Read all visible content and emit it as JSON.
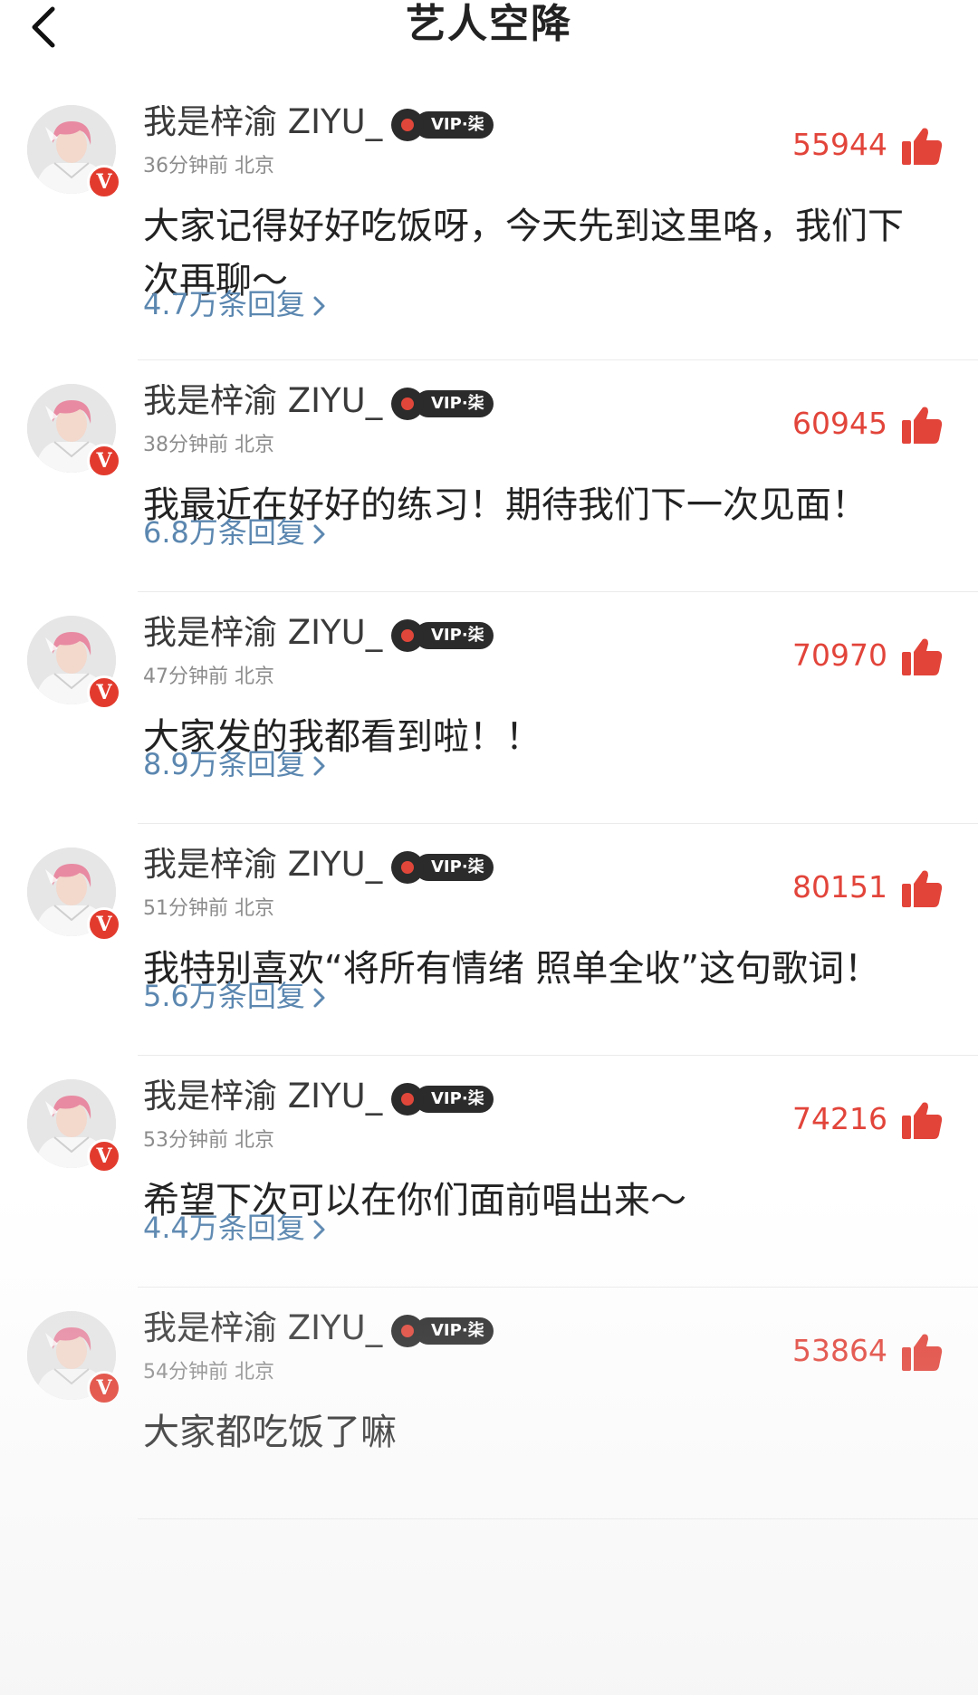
{
  "header": {
    "title": "艺人空降",
    "back_icon": "chevron-left-icon"
  },
  "colors": {
    "like": "#e2443a",
    "replies": "#5b87b0",
    "meta": "#8c8c8c",
    "verified_badge": "#e23b2e"
  },
  "comments": [
    {
      "username": "我是梓渝 ZIYU_",
      "vip_label": "VIP·柒",
      "badge": "V",
      "time": "36分钟前",
      "location": "北京",
      "likes": "55944",
      "content": "大家记得好好吃饭呀，今天先到这里咯，我们下次再聊～",
      "replies": "4.7万条回复"
    },
    {
      "username": "我是梓渝 ZIYU_",
      "vip_label": "VIP·柒",
      "badge": "V",
      "time": "38分钟前",
      "location": "北京",
      "likes": "60945",
      "content": "我最近在好好的练习！期待我们下一次见面！",
      "replies": "6.8万条回复"
    },
    {
      "username": "我是梓渝 ZIYU_",
      "vip_label": "VIP·柒",
      "badge": "V",
      "time": "47分钟前",
      "location": "北京",
      "likes": "70970",
      "content": "大家发的我都看到啦！！",
      "replies": "8.9万条回复"
    },
    {
      "username": "我是梓渝 ZIYU_",
      "vip_label": "VIP·柒",
      "badge": "V",
      "time": "51分钟前",
      "location": "北京",
      "likes": "80151",
      "content": "我特别喜欢“将所有情绪 照单全收”这句歌词！",
      "replies": "5.6万条回复"
    },
    {
      "username": "我是梓渝 ZIYU_",
      "vip_label": "VIP·柒",
      "badge": "V",
      "time": "53分钟前",
      "location": "北京",
      "likes": "74216",
      "content": "希望下次可以在你们面前唱出来～",
      "replies": "4.4万条回复"
    },
    {
      "username": "我是梓渝 ZIYU_",
      "vip_label": "VIP·柒",
      "badge": "V",
      "time": "54分钟前",
      "location": "北京",
      "likes": "53864",
      "content": "大家都吃饭了嘛",
      "replies": ""
    }
  ]
}
